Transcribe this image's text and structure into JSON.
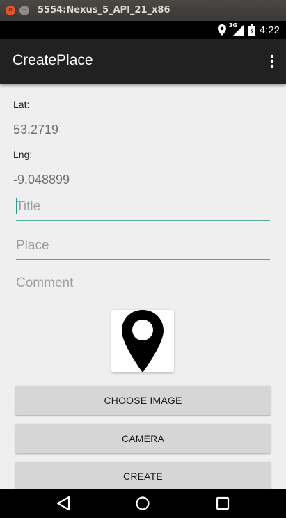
{
  "emulator": {
    "title": "5554:Nexus_5_API_21_x86"
  },
  "status_bar": {
    "network": "3G",
    "time": "4:22"
  },
  "action_bar": {
    "title": "CreatePlace"
  },
  "form": {
    "lat_label": "Lat:",
    "lat_value": "53.2719",
    "lng_label": "Lng:",
    "lng_value": "-9.048899",
    "title_placeholder": "Title",
    "place_placeholder": "Place",
    "comment_placeholder": "Comment"
  },
  "buttons": {
    "choose_image": "Choose Image",
    "camera": "Camera",
    "create": "Create"
  },
  "colors": {
    "accent": "#5aa79b",
    "action_bar": "#212121",
    "background": "#efefef"
  },
  "icons": {
    "image_preview": "map-marker-icon",
    "status": [
      "location-icon",
      "signal-icon",
      "battery-icon"
    ],
    "nav": [
      "back-icon",
      "home-icon",
      "recents-icon"
    ]
  }
}
